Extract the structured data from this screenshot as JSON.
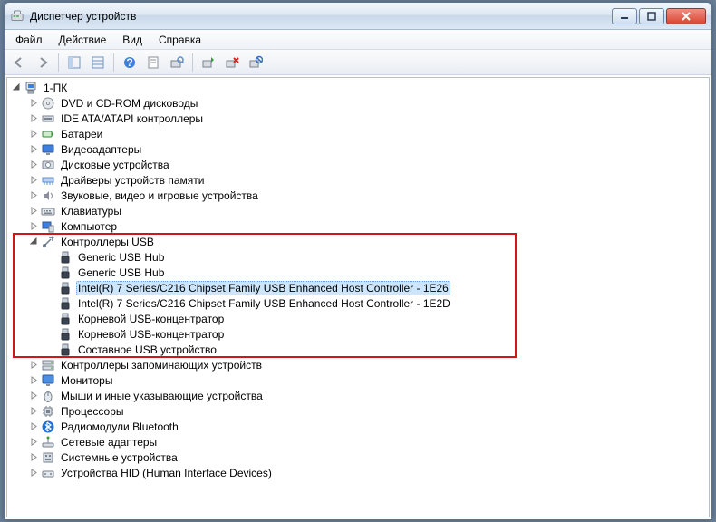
{
  "window": {
    "title": "Диспетчер устройств"
  },
  "menu": {
    "file": "Файл",
    "action": "Действие",
    "view": "Вид",
    "help": "Справка"
  },
  "tree": {
    "root": {
      "label": "1-ПК"
    },
    "categories": [
      {
        "id": "dvd",
        "label": "DVD и CD-ROM дисководы",
        "expanded": false,
        "icon": "disc"
      },
      {
        "id": "ide",
        "label": "IDE ATA/ATAPI контроллеры",
        "expanded": false,
        "icon": "ide"
      },
      {
        "id": "battery",
        "label": "Батареи",
        "expanded": false,
        "icon": "battery"
      },
      {
        "id": "video",
        "label": "Видеоадаптеры",
        "expanded": false,
        "icon": "display"
      },
      {
        "id": "disk",
        "label": "Дисковые устройства",
        "expanded": false,
        "icon": "hdd"
      },
      {
        "id": "memdrv",
        "label": "Драйверы устройств памяти",
        "expanded": false,
        "icon": "mem"
      },
      {
        "id": "sound",
        "label": "Звуковые, видео и игровые устройства",
        "expanded": false,
        "icon": "sound"
      },
      {
        "id": "keyboard",
        "label": "Клавиатуры",
        "expanded": false,
        "icon": "keyboard"
      },
      {
        "id": "computer",
        "label": "Компьютер",
        "expanded": false,
        "icon": "computer"
      },
      {
        "id": "usb",
        "label": "Контроллеры USB",
        "expanded": true,
        "icon": "usb",
        "children": [
          {
            "label": "Generic USB Hub",
            "icon": "usbdev"
          },
          {
            "label": "Generic USB Hub",
            "icon": "usbdev"
          },
          {
            "label": "Intel(R) 7 Series/C216 Chipset Family USB Enhanced Host Controller - 1E26",
            "icon": "usbdev",
            "selected": true
          },
          {
            "label": "Intel(R) 7 Series/C216 Chipset Family USB Enhanced Host Controller - 1E2D",
            "icon": "usbdev"
          },
          {
            "label": "Корневой USB-концентратор",
            "icon": "usbdev"
          },
          {
            "label": "Корневой USB-концентратор",
            "icon": "usbdev"
          },
          {
            "label": "Составное USB устройство",
            "icon": "usbdev"
          }
        ]
      },
      {
        "id": "storage",
        "label": "Контроллеры запоминающих устройств",
        "expanded": false,
        "icon": "storage"
      },
      {
        "id": "monitor",
        "label": "Мониторы",
        "expanded": false,
        "icon": "monitor"
      },
      {
        "id": "mouse",
        "label": "Мыши и иные указывающие устройства",
        "expanded": false,
        "icon": "mouse"
      },
      {
        "id": "cpu",
        "label": "Процессоры",
        "expanded": false,
        "icon": "cpu"
      },
      {
        "id": "bluetooth",
        "label": "Радиомодули Bluetooth",
        "expanded": false,
        "icon": "bt"
      },
      {
        "id": "network",
        "label": "Сетевые адаптеры",
        "expanded": false,
        "icon": "net"
      },
      {
        "id": "system",
        "label": "Системные устройства",
        "expanded": false,
        "icon": "sys"
      },
      {
        "id": "hid",
        "label": "Устройства HID (Human Interface Devices)",
        "expanded": false,
        "icon": "hid"
      }
    ]
  },
  "highlight": {
    "category_id": "usb"
  }
}
